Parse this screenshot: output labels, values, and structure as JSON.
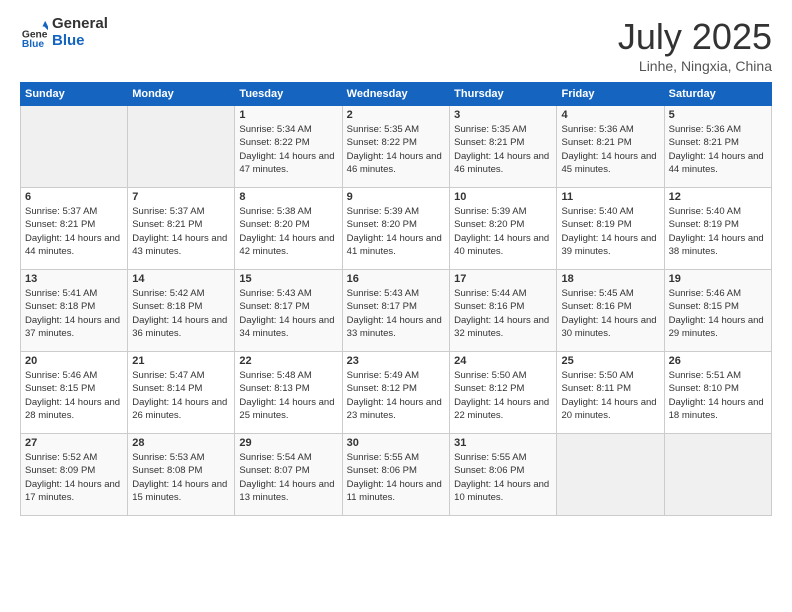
{
  "logo": {
    "general": "General",
    "blue": "Blue"
  },
  "title": "July 2025",
  "location": "Linhe, Ningxia, China",
  "weekdays": [
    "Sunday",
    "Monday",
    "Tuesday",
    "Wednesday",
    "Thursday",
    "Friday",
    "Saturday"
  ],
  "weeks": [
    [
      {
        "day": "",
        "info": ""
      },
      {
        "day": "",
        "info": ""
      },
      {
        "day": "1",
        "info": "Sunrise: 5:34 AM\nSunset: 8:22 PM\nDaylight: 14 hours and 47 minutes."
      },
      {
        "day": "2",
        "info": "Sunrise: 5:35 AM\nSunset: 8:22 PM\nDaylight: 14 hours and 46 minutes."
      },
      {
        "day": "3",
        "info": "Sunrise: 5:35 AM\nSunset: 8:21 PM\nDaylight: 14 hours and 46 minutes."
      },
      {
        "day": "4",
        "info": "Sunrise: 5:36 AM\nSunset: 8:21 PM\nDaylight: 14 hours and 45 minutes."
      },
      {
        "day": "5",
        "info": "Sunrise: 5:36 AM\nSunset: 8:21 PM\nDaylight: 14 hours and 44 minutes."
      }
    ],
    [
      {
        "day": "6",
        "info": "Sunrise: 5:37 AM\nSunset: 8:21 PM\nDaylight: 14 hours and 44 minutes."
      },
      {
        "day": "7",
        "info": "Sunrise: 5:37 AM\nSunset: 8:21 PM\nDaylight: 14 hours and 43 minutes."
      },
      {
        "day": "8",
        "info": "Sunrise: 5:38 AM\nSunset: 8:20 PM\nDaylight: 14 hours and 42 minutes."
      },
      {
        "day": "9",
        "info": "Sunrise: 5:39 AM\nSunset: 8:20 PM\nDaylight: 14 hours and 41 minutes."
      },
      {
        "day": "10",
        "info": "Sunrise: 5:39 AM\nSunset: 8:20 PM\nDaylight: 14 hours and 40 minutes."
      },
      {
        "day": "11",
        "info": "Sunrise: 5:40 AM\nSunset: 8:19 PM\nDaylight: 14 hours and 39 minutes."
      },
      {
        "day": "12",
        "info": "Sunrise: 5:40 AM\nSunset: 8:19 PM\nDaylight: 14 hours and 38 minutes."
      }
    ],
    [
      {
        "day": "13",
        "info": "Sunrise: 5:41 AM\nSunset: 8:18 PM\nDaylight: 14 hours and 37 minutes."
      },
      {
        "day": "14",
        "info": "Sunrise: 5:42 AM\nSunset: 8:18 PM\nDaylight: 14 hours and 36 minutes."
      },
      {
        "day": "15",
        "info": "Sunrise: 5:43 AM\nSunset: 8:17 PM\nDaylight: 14 hours and 34 minutes."
      },
      {
        "day": "16",
        "info": "Sunrise: 5:43 AM\nSunset: 8:17 PM\nDaylight: 14 hours and 33 minutes."
      },
      {
        "day": "17",
        "info": "Sunrise: 5:44 AM\nSunset: 8:16 PM\nDaylight: 14 hours and 32 minutes."
      },
      {
        "day": "18",
        "info": "Sunrise: 5:45 AM\nSunset: 8:16 PM\nDaylight: 14 hours and 30 minutes."
      },
      {
        "day": "19",
        "info": "Sunrise: 5:46 AM\nSunset: 8:15 PM\nDaylight: 14 hours and 29 minutes."
      }
    ],
    [
      {
        "day": "20",
        "info": "Sunrise: 5:46 AM\nSunset: 8:15 PM\nDaylight: 14 hours and 28 minutes."
      },
      {
        "day": "21",
        "info": "Sunrise: 5:47 AM\nSunset: 8:14 PM\nDaylight: 14 hours and 26 minutes."
      },
      {
        "day": "22",
        "info": "Sunrise: 5:48 AM\nSunset: 8:13 PM\nDaylight: 14 hours and 25 minutes."
      },
      {
        "day": "23",
        "info": "Sunrise: 5:49 AM\nSunset: 8:12 PM\nDaylight: 14 hours and 23 minutes."
      },
      {
        "day": "24",
        "info": "Sunrise: 5:50 AM\nSunset: 8:12 PM\nDaylight: 14 hours and 22 minutes."
      },
      {
        "day": "25",
        "info": "Sunrise: 5:50 AM\nSunset: 8:11 PM\nDaylight: 14 hours and 20 minutes."
      },
      {
        "day": "26",
        "info": "Sunrise: 5:51 AM\nSunset: 8:10 PM\nDaylight: 14 hours and 18 minutes."
      }
    ],
    [
      {
        "day": "27",
        "info": "Sunrise: 5:52 AM\nSunset: 8:09 PM\nDaylight: 14 hours and 17 minutes."
      },
      {
        "day": "28",
        "info": "Sunrise: 5:53 AM\nSunset: 8:08 PM\nDaylight: 14 hours and 15 minutes."
      },
      {
        "day": "29",
        "info": "Sunrise: 5:54 AM\nSunset: 8:07 PM\nDaylight: 14 hours and 13 minutes."
      },
      {
        "day": "30",
        "info": "Sunrise: 5:55 AM\nSunset: 8:06 PM\nDaylight: 14 hours and 11 minutes."
      },
      {
        "day": "31",
        "info": "Sunrise: 5:55 AM\nSunset: 8:06 PM\nDaylight: 14 hours and 10 minutes."
      },
      {
        "day": "",
        "info": ""
      },
      {
        "day": "",
        "info": ""
      }
    ]
  ]
}
